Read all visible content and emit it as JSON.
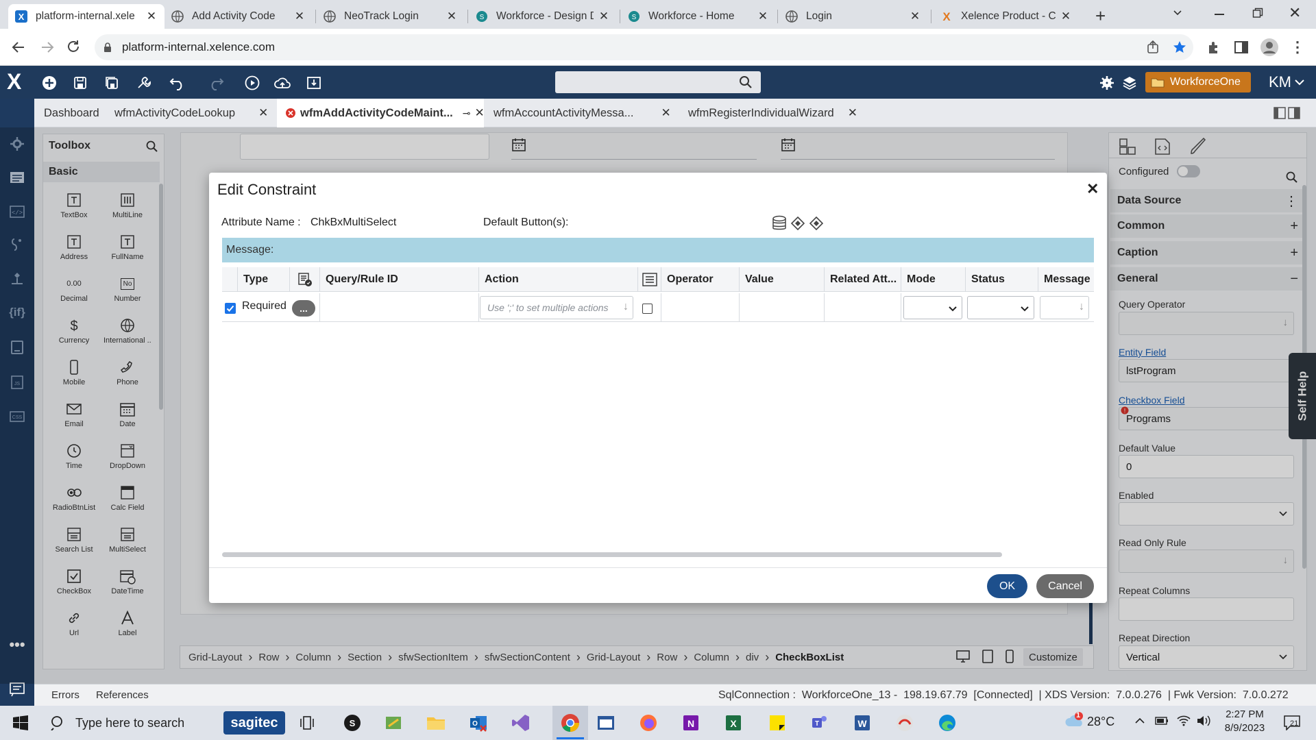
{
  "browser": {
    "tabs": [
      {
        "title": "platform-internal.xele",
        "active": true
      },
      {
        "title": "Add Activity Code"
      },
      {
        "title": "NeoTrack Login"
      },
      {
        "title": "Workforce - Design D"
      },
      {
        "title": "Workforce - Home"
      },
      {
        "title": "Login"
      },
      {
        "title": "Xelence Product - Co"
      }
    ],
    "url": "platform-internal.xelence.com"
  },
  "app": {
    "logo": "X",
    "search_placeholder": "",
    "workspace_label": "WorkforceOne",
    "user_initials": "KM"
  },
  "doc_tabs": [
    {
      "label": "Dashboard"
    },
    {
      "label": "wfmActivityCodeLookup"
    },
    {
      "label": "wfmAddActivityCodeMaint...",
      "active": true
    },
    {
      "label": "wfmAccountActivityMessa..."
    },
    {
      "label": "wfmRegisterIndividualWizard"
    }
  ],
  "toolbox": {
    "title": "Toolbox",
    "section": "Basic",
    "items": [
      {
        "label": "TextBox",
        "icon": "textbox-icon"
      },
      {
        "label": "MultiLine",
        "icon": "multiline-icon"
      },
      {
        "label": "Address",
        "icon": "address-icon"
      },
      {
        "label": "FullName",
        "icon": "fullname-icon"
      },
      {
        "label": "Decimal",
        "icon": "decimal-icon"
      },
      {
        "label": "Number",
        "icon": "number-icon"
      },
      {
        "label": "Currency",
        "icon": "currency-icon"
      },
      {
        "label": "International ...",
        "icon": "globe-icon"
      },
      {
        "label": "Mobile",
        "icon": "mobile-icon"
      },
      {
        "label": "Phone",
        "icon": "phone-icon"
      },
      {
        "label": "Email",
        "icon": "email-icon"
      },
      {
        "label": "Date",
        "icon": "calendar-icon"
      },
      {
        "label": "Time",
        "icon": "clock-icon"
      },
      {
        "label": "DropDown",
        "icon": "dropdown-icon"
      },
      {
        "label": "RadioBtnList",
        "icon": "radio-icon"
      },
      {
        "label": "Calc Field",
        "icon": "calc-icon"
      },
      {
        "label": "Search List",
        "icon": "searchlist-icon"
      },
      {
        "label": "MultiSelect",
        "icon": "multiselect-icon"
      },
      {
        "label": "CheckBox",
        "icon": "checkbox-icon"
      },
      {
        "label": "DateTime",
        "icon": "datetime-icon"
      },
      {
        "label": "Url",
        "icon": "link-icon"
      },
      {
        "label": "Label",
        "icon": "label-icon"
      }
    ],
    "decimal_glyph": "0.00",
    "number_glyph": "No"
  },
  "modal": {
    "title": "Edit Constraint",
    "attribute_name_label": "Attribute Name :",
    "attribute_name_value": "ChkBxMultiSelect",
    "default_buttons_label": "Default Button(s):",
    "message_label": "Message:",
    "columns": [
      "Type",
      "Query/Rule ID",
      "Action",
      "Operator",
      "Value",
      "Related Att...",
      "Mode",
      "Status",
      "Message ..."
    ],
    "row": {
      "checked": true,
      "type": "Required",
      "ellipsis": "...",
      "action_placeholder": "Use ';' to set multiple actions"
    },
    "ok_label": "OK",
    "cancel_label": "Cancel"
  },
  "breadcrumb": {
    "items": [
      "Grid-Layout",
      "Row",
      "Column",
      "Section",
      "sfwSectionItem",
      "sfwSectionContent",
      "Grid-Layout",
      "Row",
      "Column",
      "div",
      "CheckBoxList"
    ],
    "customize_label": "Customize"
  },
  "right_panel": {
    "configured_label": "Configured",
    "sections": [
      {
        "label": "Data Source",
        "sign": "⋮"
      },
      {
        "label": "Common",
        "sign": "+"
      },
      {
        "label": "Caption",
        "sign": "+"
      },
      {
        "label": "General",
        "sign": "−"
      }
    ],
    "fields": [
      {
        "label": "Query Operator",
        "value": ""
      },
      {
        "label": "Entity Field",
        "value": "lstProgram",
        "link": true
      },
      {
        "label": "Checkbox Field",
        "value": "Programs",
        "link": true
      },
      {
        "label": "Default Value",
        "value": "0"
      },
      {
        "label": "Enabled",
        "value": ""
      },
      {
        "label": "Read Only Rule",
        "value": ""
      },
      {
        "label": "Repeat Columns",
        "value": ""
      },
      {
        "label": "Repeat Direction",
        "value": "Vertical"
      }
    ],
    "self_help": "Self Help"
  },
  "status": {
    "errors_label": "Errors",
    "references_label": "References",
    "connection": "SqlConnection :  WorkforceOne_13 -  198.19.67.79  [Connected]  | XDS Version:  7.0.0.276  | Fwk Version:  7.0.0.272"
  },
  "taskbar": {
    "search_placeholder": "Type here to search",
    "sagitec_label": "sagitec",
    "weather_badge": "1",
    "temperature": "28°C",
    "time": "2:27 PM",
    "date": "8/9/2023",
    "notif_count": "21"
  },
  "colors": {
    "app_navy": "#1f3a5c",
    "message_bar": "#a9d4e3",
    "ok_button": "#1d4f8c",
    "cancel_button": "#6b6b6b",
    "workspace_orange": "#c8761c"
  }
}
